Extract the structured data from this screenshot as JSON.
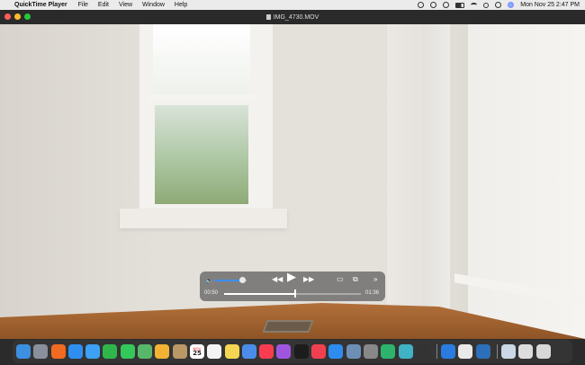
{
  "menubar": {
    "app_name": "QuickTime Player",
    "items": [
      "File",
      "Edit",
      "View",
      "Window",
      "Help"
    ],
    "clock": "Mon Nov 25  2:47 PM"
  },
  "window": {
    "title": "IMG_4730.MOV"
  },
  "player": {
    "volume_level": 0.85,
    "current_time": "00:50",
    "duration": "01:36",
    "progress": 0.52
  },
  "dock": {
    "calendar_month": "NOV",
    "calendar_day": "25",
    "icons": [
      {
        "name": "finder",
        "color": "#3d8fe0"
      },
      {
        "name": "launchpad",
        "color": "#8a8f9c"
      },
      {
        "name": "firefox",
        "color": "#f06b21"
      },
      {
        "name": "safari",
        "color": "#2f8ff0"
      },
      {
        "name": "mail",
        "color": "#3da0f5"
      },
      {
        "name": "facetime",
        "color": "#2fb64b"
      },
      {
        "name": "messages",
        "color": "#34c759"
      },
      {
        "name": "maps",
        "color": "#58b86a"
      },
      {
        "name": "photos",
        "color": "#f2b233"
      },
      {
        "name": "contacts",
        "color": "#b99766"
      },
      {
        "name": "calendar",
        "color": "#ffffff"
      },
      {
        "name": "reminders",
        "color": "#f4f4f4"
      },
      {
        "name": "notes",
        "color": "#f5d652"
      },
      {
        "name": "freeform",
        "color": "#4a8de8"
      },
      {
        "name": "music",
        "color": "#fa3c50"
      },
      {
        "name": "podcasts",
        "color": "#a055e0"
      },
      {
        "name": "tv",
        "color": "#1c1c1c"
      },
      {
        "name": "news",
        "color": "#f04050"
      },
      {
        "name": "app-store",
        "color": "#2d8cf0"
      },
      {
        "name": "preview",
        "color": "#6d8fb5"
      },
      {
        "name": "system-settings",
        "color": "#888888"
      },
      {
        "name": "app-green",
        "color": "#2eb36d"
      },
      {
        "name": "app-teal",
        "color": "#3fb2c4"
      },
      {
        "name": "piano",
        "color": "#333333"
      },
      {
        "name": "bluetooth",
        "color": "#2a7be0"
      },
      {
        "name": "chrome",
        "color": "#e9e9e9"
      },
      {
        "name": "quicktime",
        "color": "#2d6fb8"
      },
      {
        "name": "downloads-stack",
        "color": "#c9d7e6"
      },
      {
        "name": "screenshots-stack",
        "color": "#dddddd"
      },
      {
        "name": "trash",
        "color": "#d8d8d8"
      }
    ]
  }
}
